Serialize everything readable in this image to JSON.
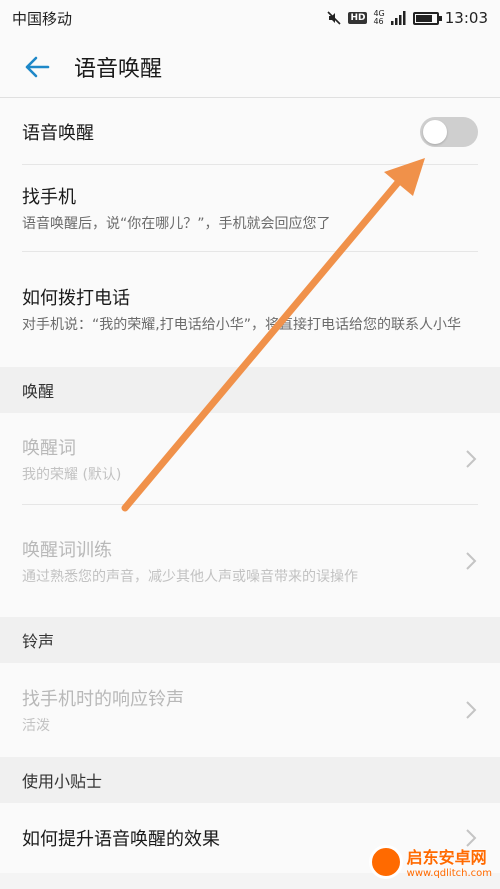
{
  "status_bar": {
    "carrier": "中国移动",
    "hd": "HD",
    "network_top": "4G",
    "network_bottom": "46",
    "time": "13:03",
    "battery_level": 0.8
  },
  "header": {
    "title": "语音唤醒"
  },
  "main": {
    "voice_wake": {
      "label": "语音唤醒",
      "toggle_on": false
    },
    "find_phone": {
      "title": "找手机",
      "subtitle": "语音唤醒后，说“你在哪儿？”，手机就会回应您了"
    },
    "how_to_call": {
      "title": "如何拨打电话",
      "subtitle": "对手机说：“我的荣耀,打电话给小华”，将直接打电话给您的联系人小华"
    }
  },
  "wake_section": {
    "header": "唤醒",
    "wake_word": {
      "title": "唤醒词",
      "subtitle": "我的荣耀 (默认)"
    },
    "wake_training": {
      "title": "唤醒词训练",
      "subtitle": "通过熟悉您的声音，减少其他人声或噪音带来的误操作"
    }
  },
  "ringtone_section": {
    "header": "铃声",
    "response_ringtone": {
      "title": "找手机时的响应铃声",
      "subtitle": "活泼"
    }
  },
  "tips_section": {
    "header": "使用小贴士",
    "improve": {
      "title": "如何提升语音唤醒的效果"
    }
  },
  "watermark": {
    "title": "启东安卓网",
    "url": "www.qdlitch.com"
  },
  "colors": {
    "accent": "#1e88c8",
    "annotation_arrow": "#f0914a",
    "toggle_off": "#cfcfcf",
    "disabled_text": "#b8b8b8",
    "watermark": "#ff6a00"
  }
}
